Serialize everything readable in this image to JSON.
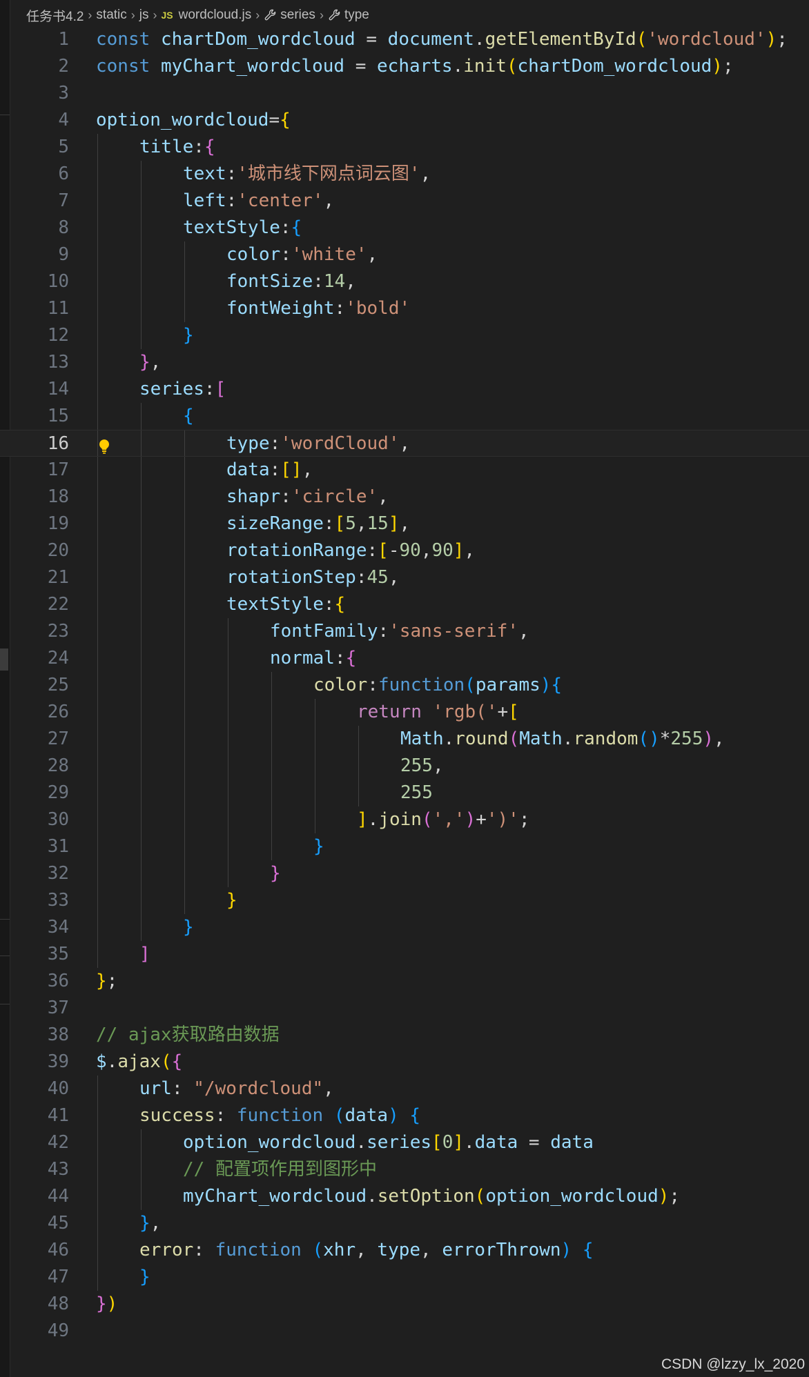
{
  "breadcrumb": {
    "items": [
      "任务书4.2",
      "static",
      "js",
      "wordcloud.js",
      "series",
      "type"
    ],
    "file_badge": "JS"
  },
  "editor": {
    "current_line": 16,
    "lines": [
      {
        "n": "1",
        "indent": 0,
        "tokens": [
          [
            "k",
            "const"
          ],
          [
            "op",
            " "
          ],
          [
            "v",
            "chartDom_wordcloud"
          ],
          [
            "op",
            " = "
          ],
          [
            "v",
            "document"
          ],
          [
            "op",
            "."
          ],
          [
            "f",
            "getElementById"
          ],
          [
            "b1",
            "("
          ],
          [
            "s",
            "'wordcloud'"
          ],
          [
            "b1",
            ")"
          ],
          [
            "op",
            ";"
          ]
        ]
      },
      {
        "n": "2",
        "indent": 0,
        "tokens": [
          [
            "k",
            "const"
          ],
          [
            "op",
            " "
          ],
          [
            "v",
            "myChart_wordcloud"
          ],
          [
            "op",
            " = "
          ],
          [
            "v",
            "echarts"
          ],
          [
            "op",
            "."
          ],
          [
            "f",
            "init"
          ],
          [
            "b1",
            "("
          ],
          [
            "v",
            "chartDom_wordcloud"
          ],
          [
            "b1",
            ")"
          ],
          [
            "op",
            ";"
          ]
        ]
      },
      {
        "n": "3",
        "indent": 0,
        "tokens": []
      },
      {
        "n": "4",
        "indent": 0,
        "tokens": [
          [
            "v",
            "option_wordcloud"
          ],
          [
            "op",
            "="
          ],
          [
            "b1",
            "{"
          ]
        ]
      },
      {
        "n": "5",
        "indent": 1,
        "tokens": [
          [
            "v",
            "title"
          ],
          [
            "op",
            ":"
          ],
          [
            "b2",
            "{"
          ]
        ]
      },
      {
        "n": "6",
        "indent": 2,
        "tokens": [
          [
            "v",
            "text"
          ],
          [
            "op",
            ":"
          ],
          [
            "s",
            "'城市线下网点词云图'"
          ],
          [
            "op",
            ","
          ]
        ]
      },
      {
        "n": "7",
        "indent": 2,
        "tokens": [
          [
            "v",
            "left"
          ],
          [
            "op",
            ":"
          ],
          [
            "s",
            "'center'"
          ],
          [
            "op",
            ","
          ]
        ]
      },
      {
        "n": "8",
        "indent": 2,
        "tokens": [
          [
            "v",
            "textStyle"
          ],
          [
            "op",
            ":"
          ],
          [
            "b3",
            "{"
          ]
        ]
      },
      {
        "n": "9",
        "indent": 3,
        "tokens": [
          [
            "v",
            "color"
          ],
          [
            "op",
            ":"
          ],
          [
            "s",
            "'white'"
          ],
          [
            "op",
            ","
          ]
        ]
      },
      {
        "n": "10",
        "indent": 3,
        "tokens": [
          [
            "v",
            "fontSize"
          ],
          [
            "op",
            ":"
          ],
          [
            "n",
            "14"
          ],
          [
            "op",
            ","
          ]
        ]
      },
      {
        "n": "11",
        "indent": 3,
        "tokens": [
          [
            "v",
            "fontWeight"
          ],
          [
            "op",
            ":"
          ],
          [
            "s",
            "'bold'"
          ]
        ]
      },
      {
        "n": "12",
        "indent": 2,
        "tokens": [
          [
            "b3",
            "}"
          ]
        ]
      },
      {
        "n": "13",
        "indent": 1,
        "tokens": [
          [
            "b2",
            "}"
          ],
          [
            "op",
            ","
          ]
        ]
      },
      {
        "n": "14",
        "indent": 1,
        "tokens": [
          [
            "v",
            "series"
          ],
          [
            "op",
            ":"
          ],
          [
            "b2",
            "["
          ]
        ]
      },
      {
        "n": "15",
        "indent": 2,
        "tokens": [
          [
            "b3",
            "{"
          ]
        ]
      },
      {
        "n": "16",
        "indent": 3,
        "tokens": [
          [
            "v",
            "type"
          ],
          [
            "op",
            ":"
          ],
          [
            "s",
            "'wordCloud'"
          ],
          [
            "op",
            ","
          ]
        ]
      },
      {
        "n": "17",
        "indent": 3,
        "tokens": [
          [
            "v",
            "data"
          ],
          [
            "op",
            ":"
          ],
          [
            "b1",
            "[]"
          ],
          [
            "op",
            ","
          ]
        ]
      },
      {
        "n": "18",
        "indent": 3,
        "tokens": [
          [
            "v",
            "shapr"
          ],
          [
            "op",
            ":"
          ],
          [
            "s",
            "'circle'"
          ],
          [
            "op",
            ","
          ]
        ]
      },
      {
        "n": "19",
        "indent": 3,
        "tokens": [
          [
            "v",
            "sizeRange"
          ],
          [
            "op",
            ":"
          ],
          [
            "b1",
            "["
          ],
          [
            "n",
            "5"
          ],
          [
            "op",
            ","
          ],
          [
            "n",
            "15"
          ],
          [
            "b1",
            "]"
          ],
          [
            "op",
            ","
          ]
        ]
      },
      {
        "n": "20",
        "indent": 3,
        "tokens": [
          [
            "v",
            "rotationRange"
          ],
          [
            "op",
            ":"
          ],
          [
            "b1",
            "["
          ],
          [
            "op",
            "-"
          ],
          [
            "n",
            "90"
          ],
          [
            "op",
            ","
          ],
          [
            "n",
            "90"
          ],
          [
            "b1",
            "]"
          ],
          [
            "op",
            ","
          ]
        ]
      },
      {
        "n": "21",
        "indent": 3,
        "tokens": [
          [
            "v",
            "rotationStep"
          ],
          [
            "op",
            ":"
          ],
          [
            "n",
            "45"
          ],
          [
            "op",
            ","
          ]
        ]
      },
      {
        "n": "22",
        "indent": 3,
        "tokens": [
          [
            "v",
            "textStyle"
          ],
          [
            "op",
            ":"
          ],
          [
            "b1",
            "{"
          ]
        ]
      },
      {
        "n": "23",
        "indent": 4,
        "tokens": [
          [
            "v",
            "fontFamily"
          ],
          [
            "op",
            ":"
          ],
          [
            "s",
            "'sans-serif'"
          ],
          [
            "op",
            ","
          ]
        ]
      },
      {
        "n": "24",
        "indent": 4,
        "tokens": [
          [
            "v",
            "normal"
          ],
          [
            "op",
            ":"
          ],
          [
            "b2",
            "{"
          ]
        ]
      },
      {
        "n": "25",
        "indent": 5,
        "tokens": [
          [
            "f",
            "color"
          ],
          [
            "op",
            ":"
          ],
          [
            "k",
            "function"
          ],
          [
            "b3",
            "("
          ],
          [
            "v",
            "params"
          ],
          [
            "b3",
            "){"
          ]
        ]
      },
      {
        "n": "26",
        "indent": 6,
        "tokens": [
          [
            "cf",
            "return"
          ],
          [
            "op",
            " "
          ],
          [
            "s",
            "'rgb('"
          ],
          [
            "op",
            "+"
          ],
          [
            "b1",
            "["
          ]
        ]
      },
      {
        "n": "27",
        "indent": 7,
        "tokens": [
          [
            "v",
            "Math"
          ],
          [
            "op",
            "."
          ],
          [
            "f",
            "round"
          ],
          [
            "b2",
            "("
          ],
          [
            "v",
            "Math"
          ],
          [
            "op",
            "."
          ],
          [
            "f",
            "random"
          ],
          [
            "b3",
            "()"
          ],
          [
            "op",
            "*"
          ],
          [
            "n",
            "255"
          ],
          [
            "b2",
            ")"
          ],
          [
            "op",
            ","
          ]
        ]
      },
      {
        "n": "28",
        "indent": 7,
        "tokens": [
          [
            "n",
            "255"
          ],
          [
            "op",
            ","
          ]
        ]
      },
      {
        "n": "29",
        "indent": 7,
        "tokens": [
          [
            "n",
            "255"
          ]
        ]
      },
      {
        "n": "30",
        "indent": 6,
        "tokens": [
          [
            "b1",
            "]"
          ],
          [
            "op",
            "."
          ],
          [
            "f",
            "join"
          ],
          [
            "b2",
            "("
          ],
          [
            "s",
            "','"
          ],
          [
            "b2",
            ")"
          ],
          [
            "op",
            "+"
          ],
          [
            "s",
            "')'"
          ],
          [
            "op",
            ";"
          ]
        ]
      },
      {
        "n": "31",
        "indent": 5,
        "tokens": [
          [
            "b3",
            "}"
          ]
        ]
      },
      {
        "n": "32",
        "indent": 4,
        "tokens": [
          [
            "b2",
            "}"
          ]
        ]
      },
      {
        "n": "33",
        "indent": 3,
        "tokens": [
          [
            "b1",
            "}"
          ]
        ]
      },
      {
        "n": "34",
        "indent": 2,
        "tokens": [
          [
            "b3",
            "}"
          ]
        ]
      },
      {
        "n": "35",
        "indent": 1,
        "tokens": [
          [
            "b2",
            "]"
          ]
        ]
      },
      {
        "n": "36",
        "indent": 0,
        "tokens": [
          [
            "b1",
            "}"
          ],
          [
            "op",
            ";"
          ]
        ]
      },
      {
        "n": "37",
        "indent": 0,
        "tokens": []
      },
      {
        "n": "38",
        "indent": 0,
        "tokens": [
          [
            "c",
            "// ajax获取路由数据"
          ]
        ]
      },
      {
        "n": "39",
        "indent": 0,
        "tokens": [
          [
            "v",
            "$"
          ],
          [
            "op",
            "."
          ],
          [
            "f",
            "ajax"
          ],
          [
            "b1",
            "("
          ],
          [
            "b2",
            "{"
          ]
        ]
      },
      {
        "n": "40",
        "indent": 1,
        "tokens": [
          [
            "v",
            "url"
          ],
          [
            "op",
            ": "
          ],
          [
            "s",
            "\"/wordcloud\""
          ],
          [
            "op",
            ","
          ]
        ]
      },
      {
        "n": "41",
        "indent": 1,
        "tokens": [
          [
            "f",
            "success"
          ],
          [
            "op",
            ": "
          ],
          [
            "k",
            "function"
          ],
          [
            "op",
            " "
          ],
          [
            "b3",
            "("
          ],
          [
            "v",
            "data"
          ],
          [
            "b3",
            ")"
          ],
          [
            "op",
            " "
          ],
          [
            "b3",
            "{"
          ]
        ]
      },
      {
        "n": "42",
        "indent": 2,
        "tokens": [
          [
            "v",
            "option_wordcloud"
          ],
          [
            "op",
            "."
          ],
          [
            "v",
            "series"
          ],
          [
            "b1",
            "["
          ],
          [
            "n",
            "0"
          ],
          [
            "b1",
            "]"
          ],
          [
            "op",
            "."
          ],
          [
            "v",
            "data"
          ],
          [
            "op",
            " = "
          ],
          [
            "v",
            "data"
          ]
        ]
      },
      {
        "n": "43",
        "indent": 2,
        "tokens": [
          [
            "c",
            "// 配置项作用到图形中"
          ]
        ]
      },
      {
        "n": "44",
        "indent": 2,
        "tokens": [
          [
            "v",
            "myChart_wordcloud"
          ],
          [
            "op",
            "."
          ],
          [
            "f",
            "setOption"
          ],
          [
            "b1",
            "("
          ],
          [
            "v",
            "option_wordcloud"
          ],
          [
            "b1",
            ")"
          ],
          [
            "op",
            ";"
          ]
        ]
      },
      {
        "n": "45",
        "indent": 1,
        "tokens": [
          [
            "b3",
            "}"
          ],
          [
            "op",
            ","
          ]
        ]
      },
      {
        "n": "46",
        "indent": 1,
        "tokens": [
          [
            "f",
            "error"
          ],
          [
            "op",
            ": "
          ],
          [
            "k",
            "function"
          ],
          [
            "op",
            " "
          ],
          [
            "b3",
            "("
          ],
          [
            "v",
            "xhr"
          ],
          [
            "op",
            ", "
          ],
          [
            "v",
            "type"
          ],
          [
            "op",
            ", "
          ],
          [
            "v",
            "errorThrown"
          ],
          [
            "b3",
            ")"
          ],
          [
            "op",
            " "
          ],
          [
            "b3",
            "{"
          ]
        ]
      },
      {
        "n": "47",
        "indent": 1,
        "tokens": [
          [
            "b3",
            "}"
          ]
        ]
      },
      {
        "n": "48",
        "indent": 0,
        "tokens": [
          [
            "b2",
            "}"
          ],
          [
            "b1",
            ")"
          ]
        ]
      },
      {
        "n": "49",
        "indent": 0,
        "tokens": []
      }
    ]
  },
  "watermark": "CSDN @lzzy_lx_2020",
  "colors": {
    "background": "#1f1f1f",
    "keyword": "#569cd6",
    "variable": "#9cdcfe",
    "function": "#dcdcaa",
    "string": "#ce9178",
    "number": "#b5cea8",
    "comment": "#6a9955",
    "bracket_1": "#ffd700",
    "bracket_2": "#da70d6",
    "bracket_3": "#179fff"
  }
}
